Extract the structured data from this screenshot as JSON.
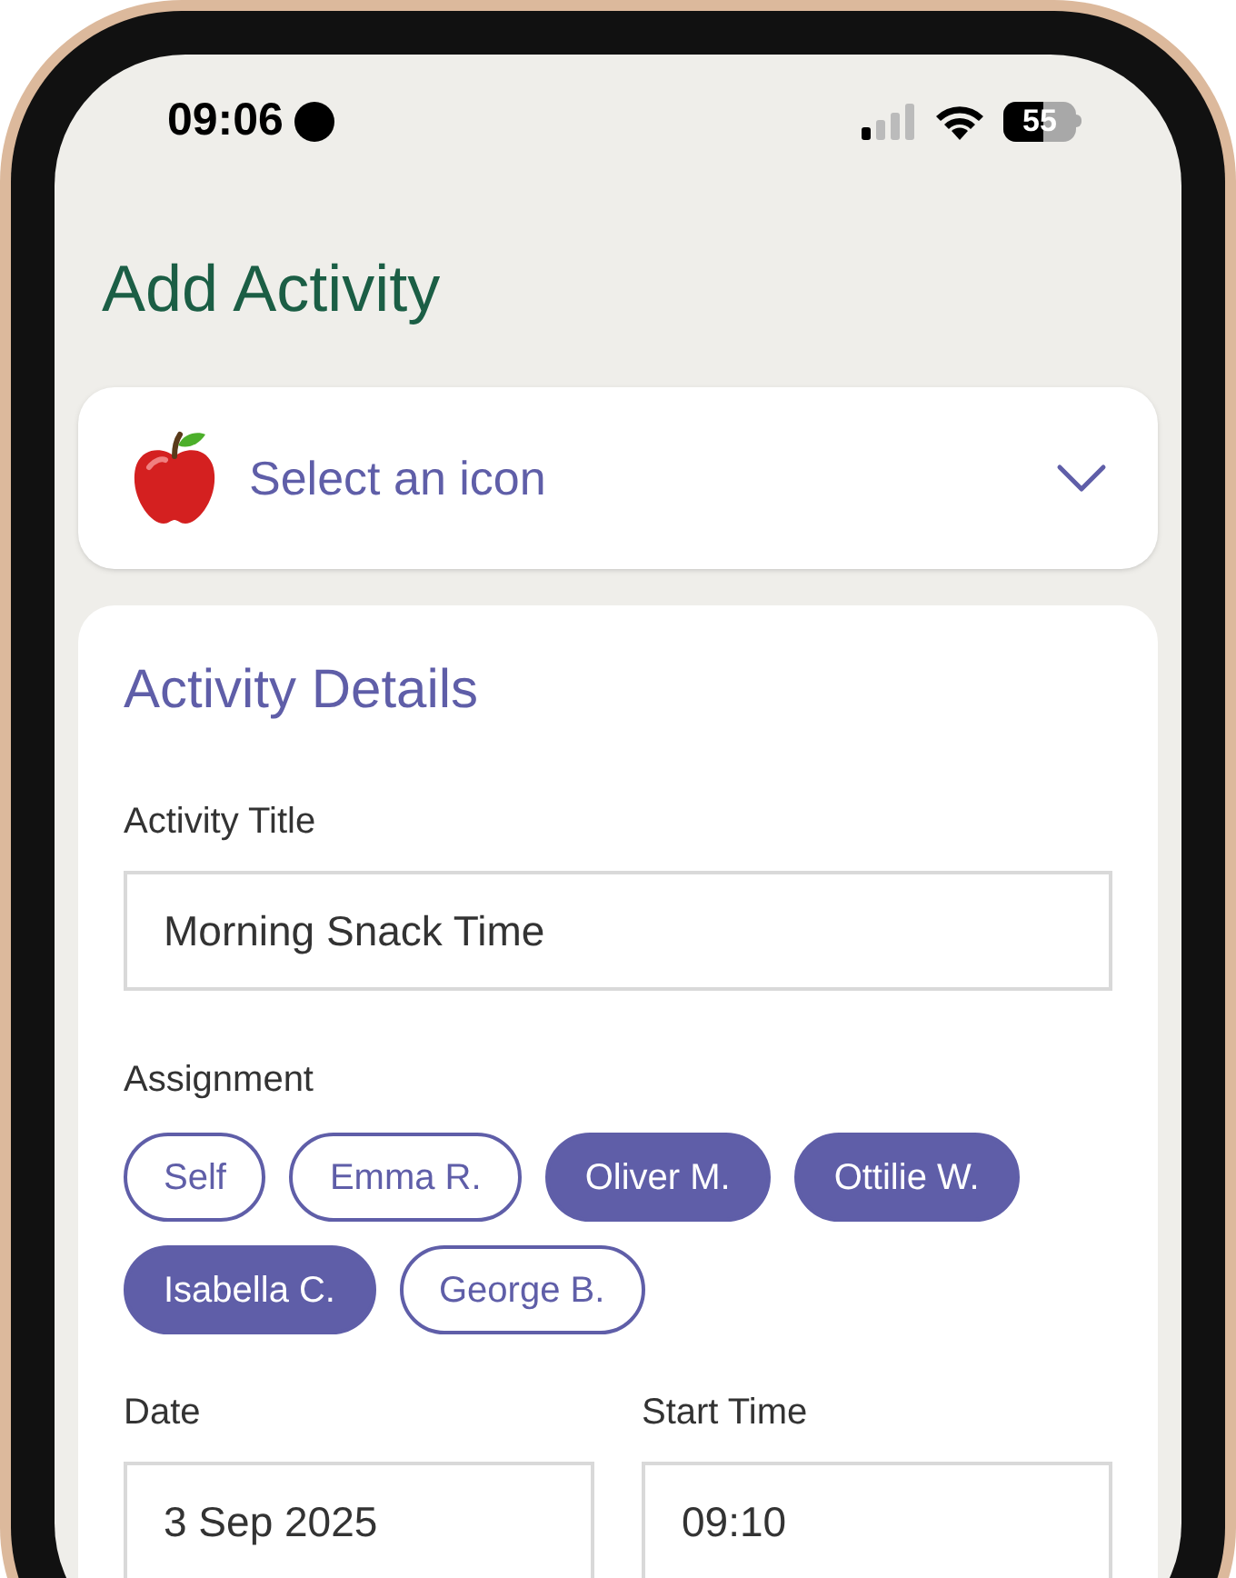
{
  "status_bar": {
    "time": "09:06",
    "battery": "55"
  },
  "title": "Add Activity",
  "icon_picker": {
    "label": "Select an icon"
  },
  "details": {
    "heading": "Activity Details",
    "activity_title": {
      "label": "Activity Title",
      "value": "Morning Snack Time"
    },
    "assignment": {
      "label": "Assignment",
      "people": [
        {
          "name": "Self",
          "selected": false
        },
        {
          "name": "Emma R.",
          "selected": false
        },
        {
          "name": "Oliver M.",
          "selected": true
        },
        {
          "name": "Ottilie W.",
          "selected": true
        },
        {
          "name": "Isabella C.",
          "selected": true
        },
        {
          "name": "George B.",
          "selected": false
        }
      ]
    },
    "date": {
      "label": "Date",
      "value": "3 Sep 2025"
    },
    "start_time": {
      "label": "Start Time",
      "value": "09:10"
    }
  }
}
